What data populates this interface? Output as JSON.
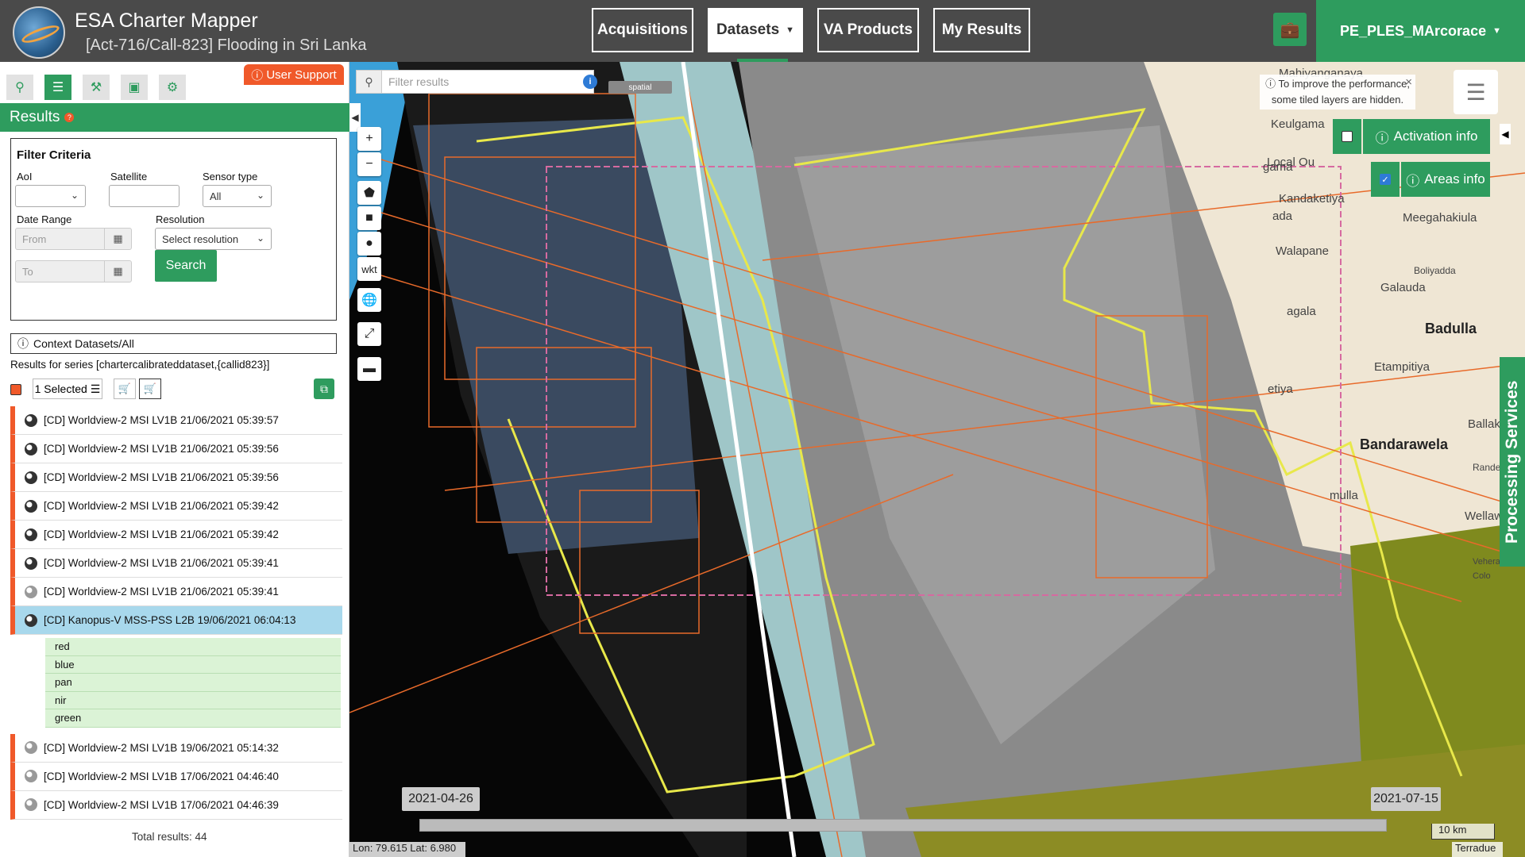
{
  "header": {
    "app_title": "ESA Charter Mapper",
    "subtitle": "[Act-716/Call-823] Flooding in Sri Lanka",
    "nav": [
      "Acquisitions",
      "Datasets",
      "VA Products",
      "My Results"
    ],
    "user": "PE_PLES_MArcorace"
  },
  "sidebar": {
    "user_support": "User Support",
    "results_title": "Results",
    "filter": {
      "title": "Filter Criteria",
      "aoi_label": "AoI",
      "satellite_label": "Satellite",
      "sensor_label": "Sensor type",
      "sensor_value": "All",
      "date_label": "Date Range",
      "from_placeholder": "From",
      "to_placeholder": "To",
      "resolution_label": "Resolution",
      "resolution_value": "Select resolution",
      "search_label": "Search"
    },
    "context": "Context Datasets/All",
    "series": "Results for series [chartercalibrateddataset,{callid823}]",
    "selected": "1 Selected",
    "results": [
      "[CD] Worldview-2 MSI LV1B 21/06/2021 05:39:57",
      "[CD] Worldview-2 MSI LV1B 21/06/2021 05:39:56",
      "[CD] Worldview-2 MSI LV1B 21/06/2021 05:39:56",
      "[CD] Worldview-2 MSI LV1B 21/06/2021 05:39:42",
      "[CD] Worldview-2 MSI LV1B 21/06/2021 05:39:42",
      "[CD] Worldview-2 MSI LV1B 21/06/2021 05:39:41",
      "[CD] Worldview-2 MSI LV1B 21/06/2021 05:39:41",
      "[CD] Kanopus-V MSS-PSS L2B 19/06/2021 06:04:13"
    ],
    "bands": [
      "red",
      "blue",
      "pan",
      "nir",
      "green"
    ],
    "results_after": [
      "[CD] Worldview-2 MSI LV1B 19/06/2021 05:14:32",
      "[CD] Worldview-2 MSI LV1B 17/06/2021 04:46:40",
      "[CD] Worldview-2 MSI LV1B 17/06/2021 04:46:39"
    ],
    "total": "Total results: 44"
  },
  "map": {
    "filter_placeholder": "Filter results",
    "spatial_label": "spatial",
    "wkt_label": "wkt",
    "perf_note_1": "To improve the performance,",
    "perf_note_2": "some tiled layers are hidden.",
    "activation_info": "Activation info",
    "areas_info": "Areas info",
    "activation_checked": false,
    "areas_checked": true,
    "processing_services": "Processing Services",
    "date_start": "2021-04-26",
    "date_end": "2021-07-15",
    "scale": "10 km",
    "coords": "Lon: 79.615 Lat: 6.980",
    "attribution": "Terradue",
    "towns": [
      "Mahiyanganaya",
      "Keulgama",
      "Local Ou",
      "gama",
      "Kandaketiya",
      "Meegahakiula",
      "ada",
      "Walapane",
      "Boliyadda",
      "Galauda",
      "agala",
      "Badulla",
      "Etampitiya",
      "etiya",
      "Ballaketu",
      "Bandarawela",
      "Rande",
      "mulla",
      "Wellawa",
      "Vehera",
      "Colo"
    ]
  },
  "colors": {
    "header_bg": "#4a4a4a",
    "accent_green": "#2e9c5e",
    "accent_orange": "#f0592a",
    "highlight_row": "#a8d8ec",
    "band_bg": "#dbf3d6"
  }
}
